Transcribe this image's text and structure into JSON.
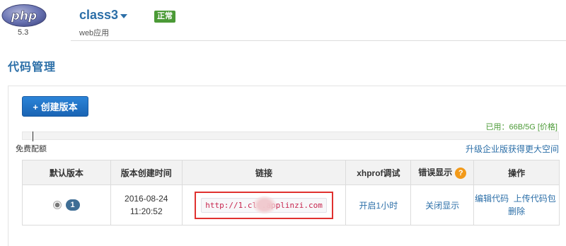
{
  "header": {
    "logo_text": "php",
    "php_version": "5.3",
    "app_name": "class3",
    "app_type": "web应用",
    "status": "正常"
  },
  "section_title": "代码管理",
  "toolbar": {
    "create_label": "+ 创建版本"
  },
  "quota": {
    "usage_prefix": "已用：66B/5G",
    "price_link": "[价格]",
    "used_fraction": 0.0,
    "free_label": "免费配额",
    "upgrade_link": "升级企业版获得更大空间"
  },
  "table": {
    "headers": {
      "default_version": "默认版本",
      "created_time": "版本创建时间",
      "link": "链接",
      "xhprof": "xhprof调试",
      "error_display": "错误显示",
      "actions": "操作"
    },
    "help_icon_glyph": "?",
    "rows": [
      {
        "version": "1",
        "date": "2016-08-24",
        "time": "11:20:52",
        "link": "http://1.cl   .applinzi.com",
        "xhprof_action": "开启1小时",
        "error_action": "关闭显示",
        "edit_code": "编辑代码",
        "upload_package": "上传代码包",
        "delete": "删除"
      }
    ]
  },
  "colors": {
    "accent_blue": "#2c6fa8",
    "status_green": "#4b9a36",
    "highlight_red": "#e0312f",
    "help_orange": "#f29a1a"
  }
}
